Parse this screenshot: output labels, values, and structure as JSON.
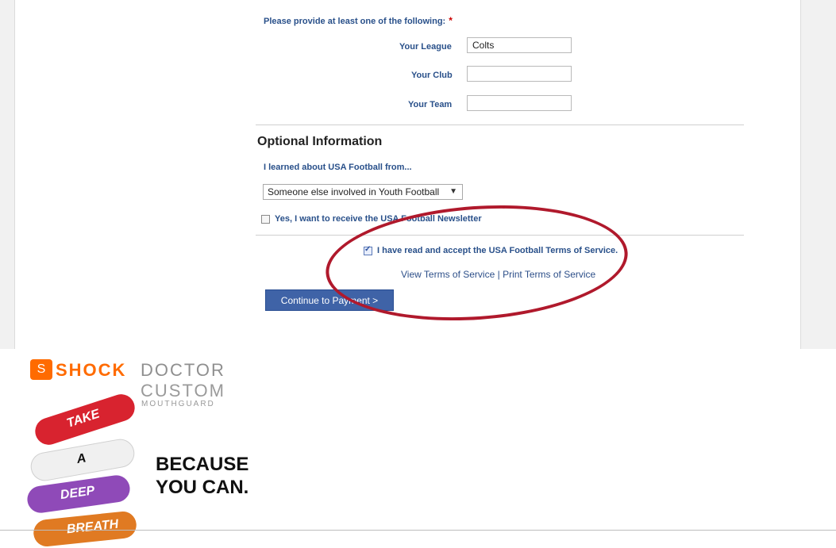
{
  "form": {
    "provide_text": "Please provide at least one of the following:",
    "required_marker": "*",
    "league_label": "Your League",
    "league_value": "Colts",
    "club_label": "Your Club",
    "club_value": "",
    "team_label": "Your Team",
    "team_value": ""
  },
  "optional": {
    "title": "Optional Information",
    "learned_label": "I learned about USA Football from...",
    "learned_selected": "Someone else involved in Youth Football",
    "newsletter_label": "Yes, I want to receive the USA Football Newsletter",
    "newsletter_checked": false
  },
  "terms": {
    "accept_label": "I have read and accept the USA Football Terms of Service.",
    "accept_checked": true,
    "view_link": "View Terms of Service",
    "separator": "|",
    "print_link": "Print Terms of Service"
  },
  "actions": {
    "continue_label": "Continue to Payment >"
  },
  "ad": {
    "brand_1": "SHOCK",
    "brand_2": "DOCTOR",
    "brand_3": "CUSTOM",
    "brand_4": "MOUTHGUARD",
    "word_1": "TAKE",
    "word_2": "A",
    "word_3": "DEEP",
    "word_4": "BREATH",
    "tagline_1": "BECAUSE",
    "tagline_2": "YOU CAN.",
    "colors": {
      "take": "#d8232f",
      "a": "#f0f0f0",
      "deep": "#8f4ab8",
      "breath": "#e07a22",
      "accent": "#ff6b00"
    }
  },
  "colors": {
    "label_blue": "#29508a",
    "button_blue": "#3f63a7",
    "circle_red": "#b0192c"
  }
}
